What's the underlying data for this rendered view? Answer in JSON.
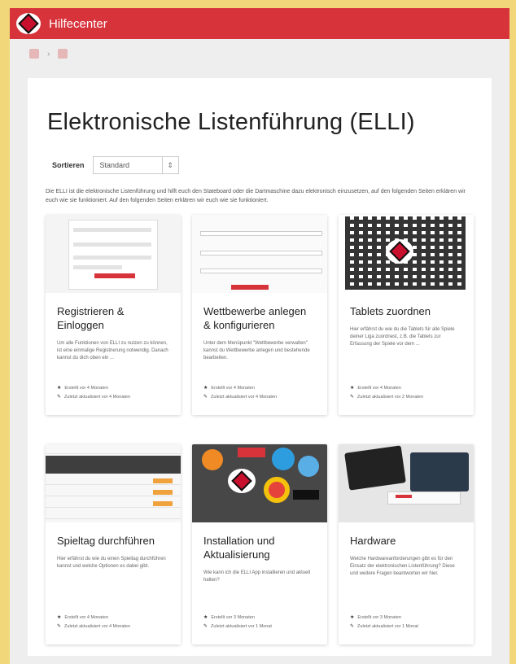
{
  "app": {
    "title": "Hilfecenter"
  },
  "breadcrumb": {
    "home_label": "A",
    "current_label": "S"
  },
  "page": {
    "title": "Elektronische Listenführung (ELLI)",
    "sort_label": "Sortieren",
    "sort_value": "Standard",
    "intro": "Die ELLI ist die elektronische Listenführung und hilft euch den Stateboard oder die Dartmaschine dazu elektronisch einzusetzen, auf den folgenden Seiten erklären wir euch wie sie funktioniert. Auf den folgenden Seiten erklären wir euch wie sie funktioniert."
  },
  "colors": {
    "brand_red": "#d7333b",
    "background": "#f2d77a"
  },
  "cards": [
    {
      "title": "Registrieren & Einloggen",
      "desc": "Um alle Funktionen von ELLI zu nutzen zu können, ist eine einmalige Registrierung notwendig. Danach kannst du dich oben ein ...",
      "meta1": "Erstellt vor 4 Monaten",
      "meta2": "Zuletzt aktualisiert vor 4 Monaten"
    },
    {
      "title": "Wettbewerbe anlegen & konfigurieren",
      "desc": "Unter dem Menüpunkt \"Wettbewerbe verwalten\" kannst du Wettbewerbe anlegen und bestehende bearbeiten.",
      "meta1": "Erstellt vor 4 Monaten",
      "meta2": "Zuletzt aktualisiert vor 4 Monaten"
    },
    {
      "title": "Tablets zuordnen",
      "desc": "Hier erfährst du wie du die Tablets für alle Spiele deiner Liga zuordnest, z.B. die Tablets zur Erfassung der Spiele vor dem ...",
      "meta1": "Erstellt vor 4 Monaten",
      "meta2": "Zuletzt aktualisiert vor 2 Monaten"
    },
    {
      "title": "Spieltag durchführen",
      "desc": "Hier erfährst du wie du einen Spieltag durchführen kannst und welche Optionen es dabei gibt.",
      "meta1": "Erstellt vor 4 Monaten",
      "meta2": "Zuletzt aktualisiert vor 4 Monaten"
    },
    {
      "title": "Installation und Aktualisierung",
      "desc": "Wie kann ich die ELLI App installieren und aktuell halten?",
      "meta1": "Erstellt vor 3 Monaten",
      "meta2": "Zuletzt aktualisiert vor 1 Monat"
    },
    {
      "title": "Hardware",
      "desc": "Welche Hardwareanforderungen gibt es für den Einsatz der elektronischen Listenführung? Diese und weitere Fragen beantworten wir hier.",
      "meta1": "Erstellt vor 3 Monaten",
      "meta2": "Zuletzt aktualisiert vor 1 Monat"
    }
  ]
}
